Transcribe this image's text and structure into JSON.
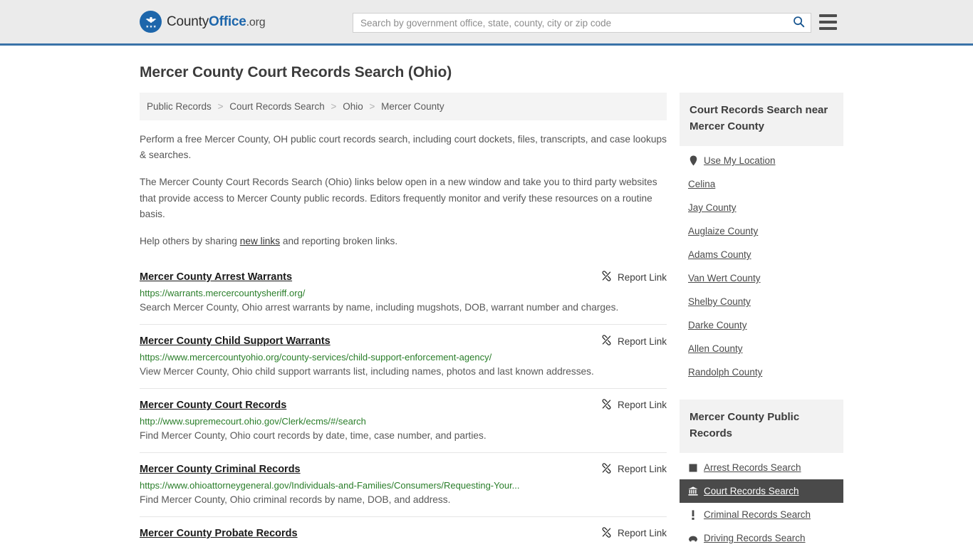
{
  "header": {
    "logo": {
      "part1": "County",
      "part2": "Office",
      "part3": ".org",
      "icon": "eagle-shield-logo"
    },
    "search": {
      "placeholder": "Search by government office, state, county, city or zip code",
      "value": "",
      "icon": "search-icon"
    },
    "menu_icon": "hamburger-menu-icon",
    "accent_color": "#3a73a8",
    "background": "#ebebeb"
  },
  "page": {
    "title": "Mercer County Court Records Search (Ohio)"
  },
  "breadcrumb": {
    "separator": ">",
    "items": [
      {
        "label": "Public Records"
      },
      {
        "label": "Court Records Search"
      },
      {
        "label": "Ohio"
      },
      {
        "label": "Mercer County"
      }
    ]
  },
  "intro": {
    "p1": "Perform a free Mercer County, OH public court records search, including court dockets, files, transcripts, and case lookups & searches.",
    "p2": "The Mercer County Court Records Search (Ohio) links below open in a new window and take you to third party websites that provide access to Mercer County public records. Editors frequently monitor and verify these resources on a routine basis.",
    "p3_before": "Help others by sharing ",
    "p3_link": "new links",
    "p3_after": " and reporting broken links."
  },
  "results": {
    "report_label": "Report Link",
    "report_icon": "broken-link-icon",
    "items": [
      {
        "title": "Mercer County Arrest Warrants",
        "url": "https://warrants.mercercountysheriff.org/",
        "description": "Search Mercer County, Ohio arrest warrants by name, including mugshots, DOB, warrant number and charges."
      },
      {
        "title": "Mercer County Child Support Warrants",
        "url": "https://www.mercercountyohio.org/county-services/child-support-enforcement-agency/",
        "description": "View Mercer County, Ohio child support warrants list, including names, photos and last known addresses."
      },
      {
        "title": "Mercer County Court Records",
        "url": "http://www.supremecourt.ohio.gov/Clerk/ecms/#/search",
        "description": "Find Mercer County, Ohio court records by date, time, case number, and parties."
      },
      {
        "title": "Mercer County Criminal Records",
        "url": "https://www.ohioattorneygeneral.gov/Individuals-and-Families/Consumers/Requesting-Your...",
        "description": "Find Mercer County, Ohio criminal records by name, DOB, and address."
      },
      {
        "title": "Mercer County Probate Records",
        "url": "",
        "description": ""
      }
    ]
  },
  "sidebar": {
    "near_heading": "Court Records Search near Mercer County",
    "near_links": [
      {
        "label": "Use My Location",
        "icon": "map-pin-icon"
      },
      {
        "label": "Celina",
        "icon": ""
      },
      {
        "label": "Jay County",
        "icon": ""
      },
      {
        "label": "Auglaize County",
        "icon": ""
      },
      {
        "label": "Adams County",
        "icon": ""
      },
      {
        "label": "Van Wert County",
        "icon": ""
      },
      {
        "label": "Shelby County",
        "icon": ""
      },
      {
        "label": "Darke County",
        "icon": ""
      },
      {
        "label": "Allen County",
        "icon": ""
      },
      {
        "label": "Randolph County",
        "icon": ""
      }
    ],
    "public_records_heading": "Mercer County Public Records",
    "public_records_links": [
      {
        "label": "Arrest Records Search",
        "icon": "building-icon",
        "active": false
      },
      {
        "label": "Court Records Search",
        "icon": "courthouse-icon",
        "active": true
      },
      {
        "label": "Criminal Records Search",
        "icon": "exclamation-icon",
        "active": false
      },
      {
        "label": "Driving Records Search",
        "icon": "car-icon",
        "active": false
      }
    ],
    "active_background": "#4a4a4a",
    "heading_background": "#f2f2f2"
  }
}
